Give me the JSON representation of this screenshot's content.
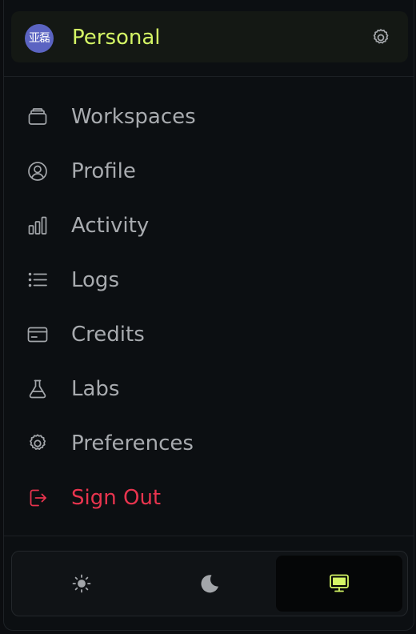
{
  "header": {
    "avatar_text": "亚磊",
    "title": "Personal",
    "settings_icon": "gear-icon"
  },
  "menu": {
    "items": [
      {
        "label": "Workspaces",
        "icon": "layers-icon"
      },
      {
        "label": "Profile",
        "icon": "user-circle-icon"
      },
      {
        "label": "Activity",
        "icon": "bar-chart-icon"
      },
      {
        "label": "Logs",
        "icon": "list-icon"
      },
      {
        "label": "Credits",
        "icon": "credit-card-icon"
      },
      {
        "label": "Labs",
        "icon": "flask-icon"
      },
      {
        "label": "Preferences",
        "icon": "gear-icon"
      },
      {
        "label": "Sign Out",
        "icon": "sign-out-icon",
        "color": "#e8344e"
      }
    ]
  },
  "theme": {
    "options": [
      {
        "name": "light",
        "icon": "sun-icon"
      },
      {
        "name": "dark",
        "icon": "moon-icon"
      },
      {
        "name": "system",
        "icon": "monitor-icon",
        "selected": true
      }
    ]
  },
  "colors": {
    "accent": "#d4f565",
    "danger": "#e8344e",
    "text_muted": "#a8abaf",
    "avatar_bg": "#5b64c2"
  }
}
